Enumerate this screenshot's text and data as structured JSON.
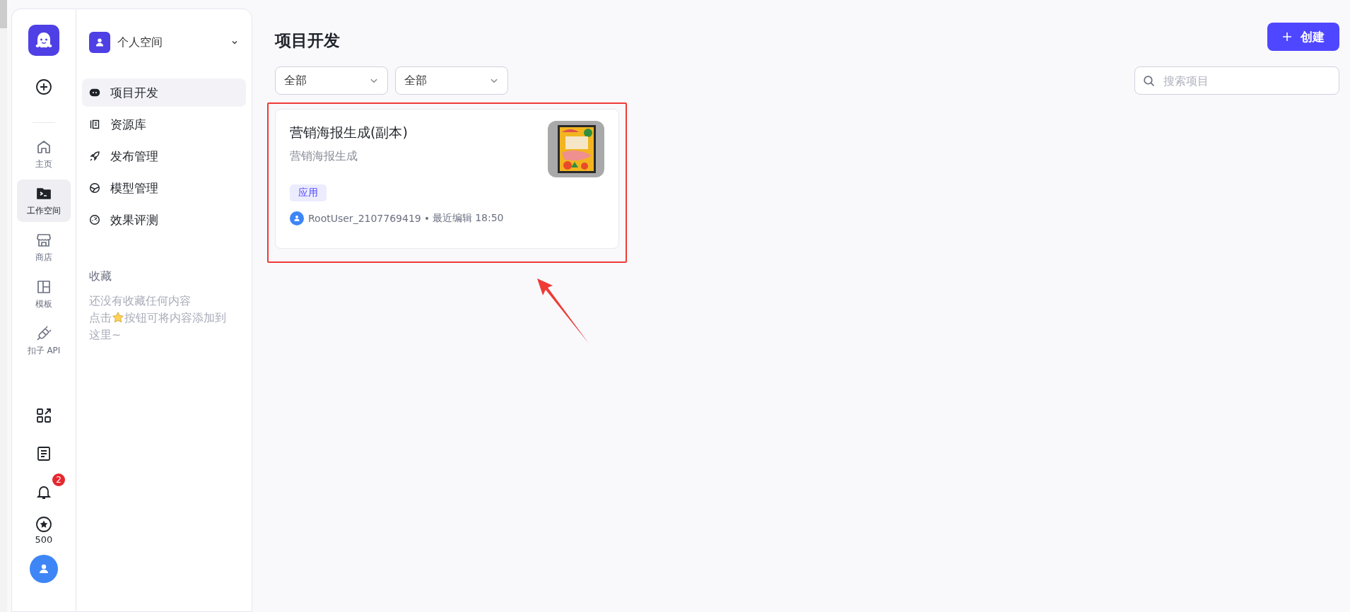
{
  "rail": {
    "items": [
      {
        "label": "主页",
        "selected": false
      },
      {
        "label": "工作空间",
        "selected": true
      },
      {
        "label": "商店",
        "selected": false
      },
      {
        "label": "模板",
        "selected": false
      },
      {
        "label": "扣子 API",
        "selected": false
      }
    ],
    "notifications": {
      "badge": "2"
    },
    "points": "500"
  },
  "sidebar": {
    "space": {
      "name": "个人空间"
    },
    "items": [
      {
        "label": "项目开发",
        "selected": true
      },
      {
        "label": "资源库",
        "selected": false
      },
      {
        "label": "发布管理",
        "selected": false
      },
      {
        "label": "模型管理",
        "selected": false
      },
      {
        "label": "效果评测",
        "selected": false
      }
    ],
    "favorites": {
      "title": "收藏",
      "empty_line_1": "还没有收藏任何内容",
      "empty_line_2_before": "点击",
      "empty_line_2_after": "按钮可将内容添加到",
      "empty_line_3": "这里~"
    }
  },
  "main": {
    "title": "项目开发",
    "create_button": "创建",
    "filters": [
      {
        "value": "全部"
      },
      {
        "value": "全部"
      }
    ],
    "search": {
      "placeholder": "搜索项目"
    },
    "projects": [
      {
        "title": "营销海报生成(副本)",
        "description": "营销海报生成",
        "tag": "应用",
        "author": "RootUser_2107769419",
        "edited": "最近编辑 18:50",
        "highlighted": true
      }
    ]
  }
}
